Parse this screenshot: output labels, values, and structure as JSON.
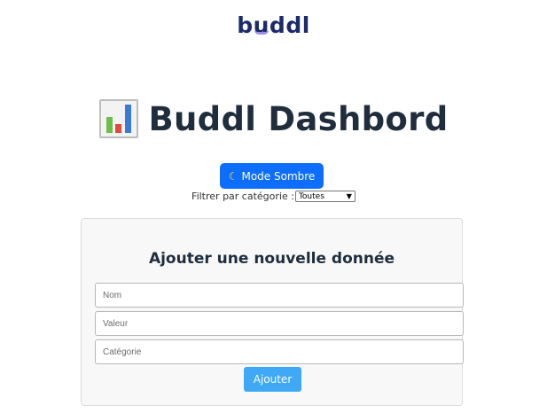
{
  "logo": {
    "text_b": "b",
    "text_u": "u",
    "text_rest": "ddl"
  },
  "header": {
    "title": "Buddl Dashbord",
    "title_icon": "bar-chart-icon"
  },
  "theme_toggle": {
    "label": "Mode Sombre",
    "icon": "moon-icon"
  },
  "filter": {
    "label": "Filtrer par catégorie :",
    "selected": "Toutes"
  },
  "form": {
    "title": "Ajouter une nouvelle donnée",
    "name_placeholder": "Nom",
    "value_placeholder": "Valeur",
    "category_placeholder": "Catégorie",
    "submit_label": "Ajouter"
  },
  "colors": {
    "primary": "#0d6efd",
    "submit": "#3fa9f5",
    "title": "#1f2d3d",
    "logo": "#1b2a6b",
    "logo_accent": "#9c8ee8"
  }
}
